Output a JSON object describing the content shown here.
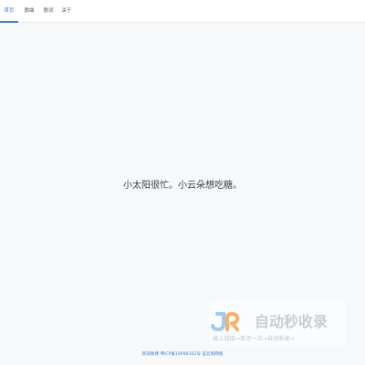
{
  "nav": {
    "items": [
      {
        "label": "首页",
        "active": true
      },
      {
        "label": "歌曲",
        "active": false
      },
      {
        "label": "歌词",
        "active": false
      },
      {
        "label": "关于",
        "active": false
      }
    ],
    "accent_color": "#3b82d6"
  },
  "main": {
    "message": "小太阳很忙。小云朵想吃糖。"
  },
  "watermark": {
    "title": "自动秒收录",
    "slogan": "做上链接→来访一次→自动收录→"
  },
  "footer": {
    "text": "新浪微博 粤ICP备19090102号 蓝云照网络"
  }
}
